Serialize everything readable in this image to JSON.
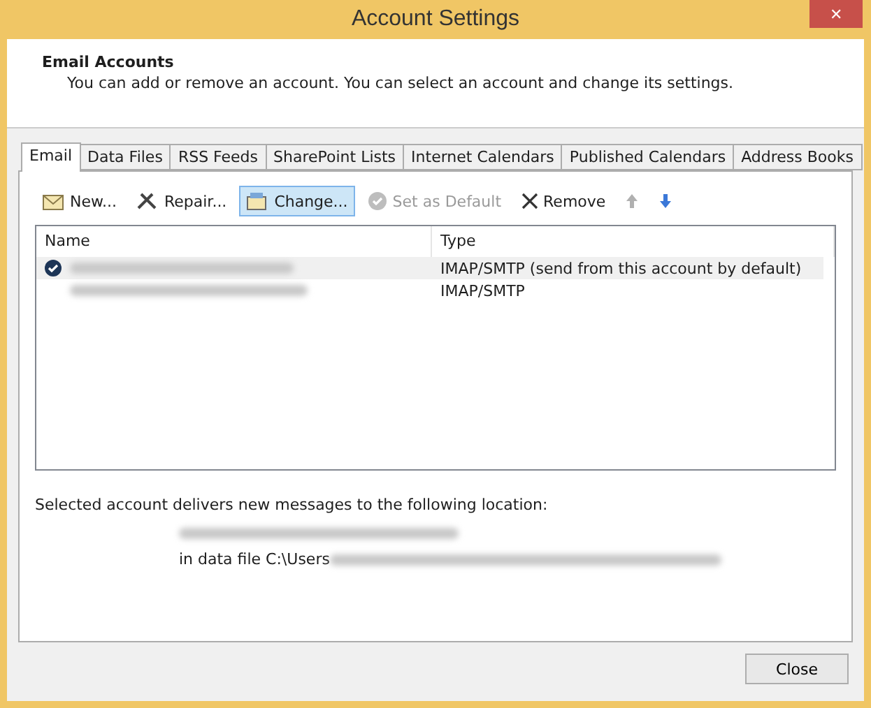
{
  "window": {
    "title": "Account Settings",
    "close": "✕"
  },
  "header": {
    "title": "Email Accounts",
    "description": "You can add or remove an account. You can select an account and change its settings."
  },
  "tabs": [
    {
      "label": "Email",
      "selected": true
    },
    {
      "label": "Data Files",
      "selected": false
    },
    {
      "label": "RSS Feeds",
      "selected": false
    },
    {
      "label": "SharePoint Lists",
      "selected": false
    },
    {
      "label": "Internet Calendars",
      "selected": false
    },
    {
      "label": "Published Calendars",
      "selected": false
    },
    {
      "label": "Address Books",
      "selected": false
    }
  ],
  "toolbar": [
    {
      "kind": "new",
      "label": "New...",
      "disabled": false,
      "hovered": false
    },
    {
      "kind": "repair",
      "label": "Repair...",
      "disabled": false,
      "hovered": false
    },
    {
      "kind": "change",
      "label": "Change...",
      "disabled": false,
      "hovered": true
    },
    {
      "kind": "default",
      "label": "Set as Default",
      "disabled": true,
      "hovered": false
    },
    {
      "kind": "remove",
      "label": "Remove",
      "disabled": false,
      "hovered": false
    },
    {
      "kind": "up",
      "disabled": true,
      "hovered": false
    },
    {
      "kind": "down",
      "disabled": false,
      "hovered": false
    }
  ],
  "table": {
    "columns": [
      "Name",
      "Type"
    ],
    "rows": [
      {
        "type": "IMAP/SMTP (send from this account by default)",
        "default": true,
        "selected": true
      },
      {
        "type": "IMAP/SMTP",
        "default": false,
        "selected": false
      }
    ]
  },
  "location": {
    "intro": "Selected account delivers new messages to the following location:",
    "data_file": "in data file C:\\Users"
  },
  "buttons": [
    "Close"
  ]
}
